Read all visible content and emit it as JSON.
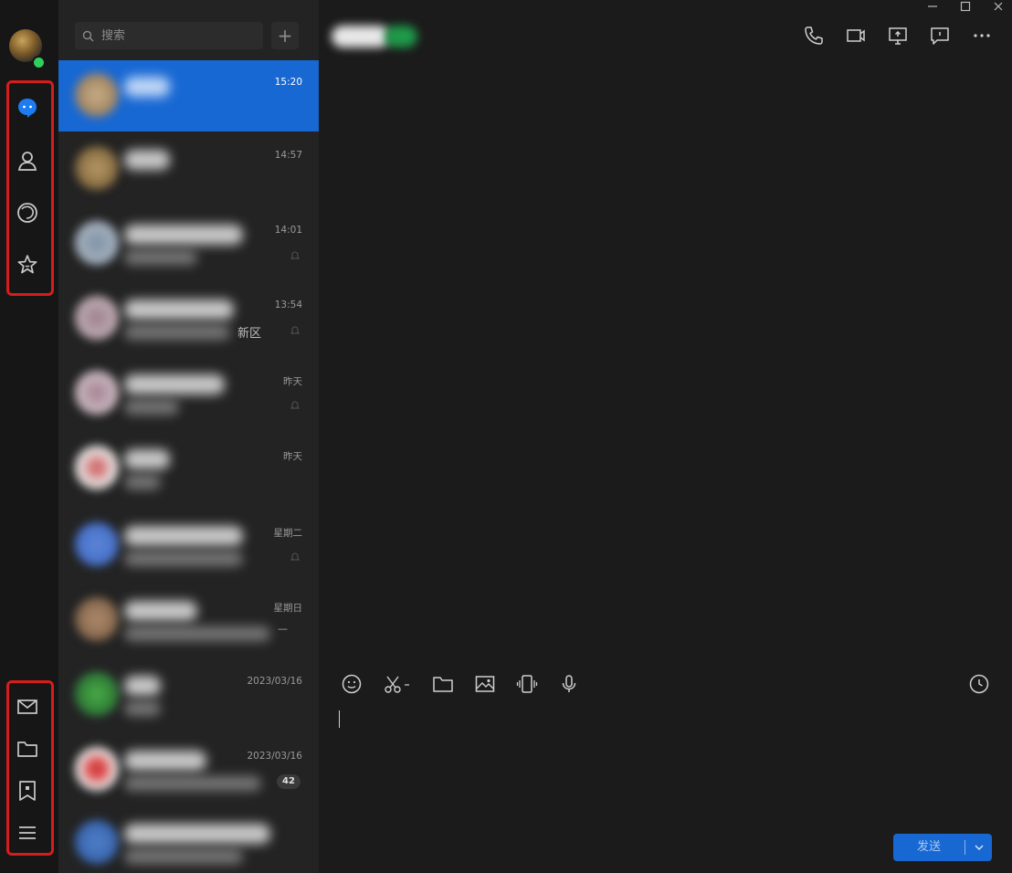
{
  "nav": {
    "top_items": [
      {
        "name": "messages",
        "icon": "chat-bubble-icon",
        "active": true
      },
      {
        "name": "contacts",
        "icon": "person-icon"
      },
      {
        "name": "moments",
        "icon": "aperture-icon"
      },
      {
        "name": "favorites",
        "icon": "star-icon"
      }
    ],
    "bottom_items": [
      {
        "name": "mail",
        "icon": "mail-icon"
      },
      {
        "name": "files",
        "icon": "folder-icon"
      },
      {
        "name": "bookmarks",
        "icon": "bookmark-icon"
      },
      {
        "name": "menu",
        "icon": "menu-icon"
      }
    ]
  },
  "search": {
    "placeholder": "搜索"
  },
  "add_button": {
    "label": "+"
  },
  "conversations": [
    {
      "time": "15:20",
      "active": true
    },
    {
      "time": "14:57"
    },
    {
      "time": "14:01",
      "muted": true
    },
    {
      "time": "13:54",
      "muted": true,
      "extra": "新区"
    },
    {
      "time": "昨天",
      "muted": true
    },
    {
      "time": "昨天"
    },
    {
      "time": "星期二",
      "muted": true
    },
    {
      "time": "星期日",
      "extra": "—"
    },
    {
      "time": "2023/03/16"
    },
    {
      "time": "2023/03/16",
      "badge": "42"
    },
    {
      "time": ""
    }
  ],
  "composer": {
    "send_label": "发送"
  },
  "colors": {
    "accent": "#1868d3",
    "highlight_box": "#d61d1d",
    "online": "#2fcf5c"
  }
}
